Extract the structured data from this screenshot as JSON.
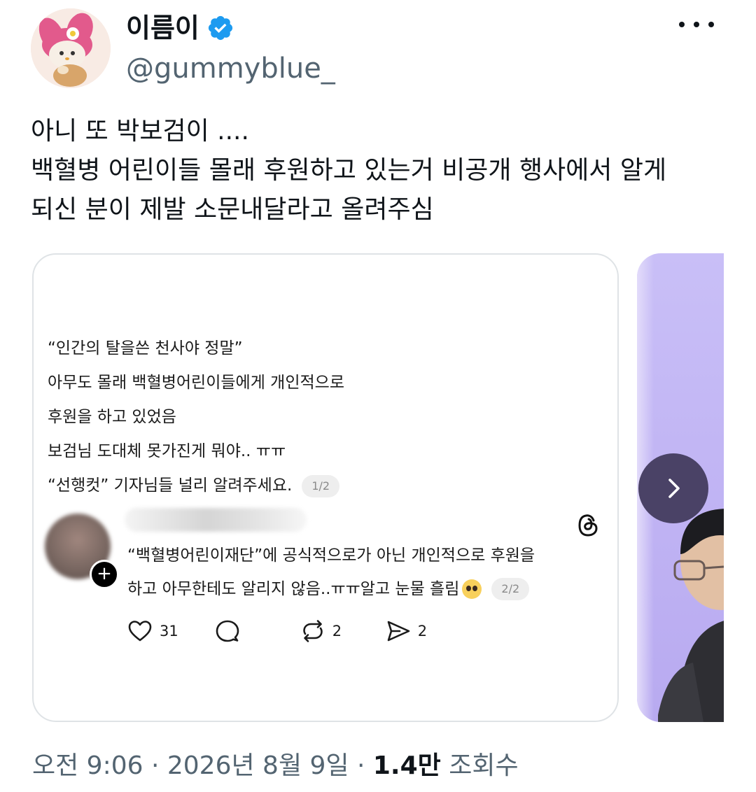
{
  "author": {
    "display_name": "이름이",
    "handle": "@gummyblue_",
    "verified": true,
    "avatar_icon": "my-melody-character-avatar",
    "more_icon": "more-dots-icon"
  },
  "tweet": {
    "lines": [
      "아니 또 박보검이 ....",
      "백혈병 어린이들 몰래 후원하고 있는거 비공개 행사에서 알게",
      "되신 분이 제발 소문내달라고 올려주심"
    ]
  },
  "media": {
    "card1": {
      "post_lines": [
        "“인간의 탈을쓴 천사야 정말”",
        "아무도 몰래 백혈병어린이들에게 개인적으로",
        "후원을 하고 있었음",
        "보검님 도대체 못가진게 뭐야.. ㅠㅠ",
        "“선행컷” 기자님들 널리 알려주세요."
      ],
      "post_page": "1/2",
      "reply_lines": [
        "“백혈병어린이재단”에 공식적으로가 아닌 개인적으로 후원을",
        "하고 아무한테도 알리지 않음..ㅠㅠ알고 눈물 흘림"
      ],
      "reply_page": "2/2",
      "reply_emoji": "pleading-face-emoji",
      "actions": [
        {
          "icon": "heart-icon",
          "count": "31"
        },
        {
          "icon": "comment-icon",
          "count": ""
        },
        {
          "icon": "repost-icon",
          "count": "2"
        },
        {
          "icon": "share-icon",
          "count": "2"
        }
      ]
    },
    "next_icon": "chevron-right-icon"
  },
  "meta": {
    "time_date": "오전 9:06 · 2026년 8월 9일 · ",
    "views_count": "1.4만",
    "views_label": " 조회수"
  },
  "colors": {
    "text": "#0f1419",
    "secondary": "#536471",
    "verified": "#1d9bf0",
    "card_border": "#dfe3e6",
    "carousel_button": "#4a4266",
    "peek_background": "#c9bff7"
  }
}
